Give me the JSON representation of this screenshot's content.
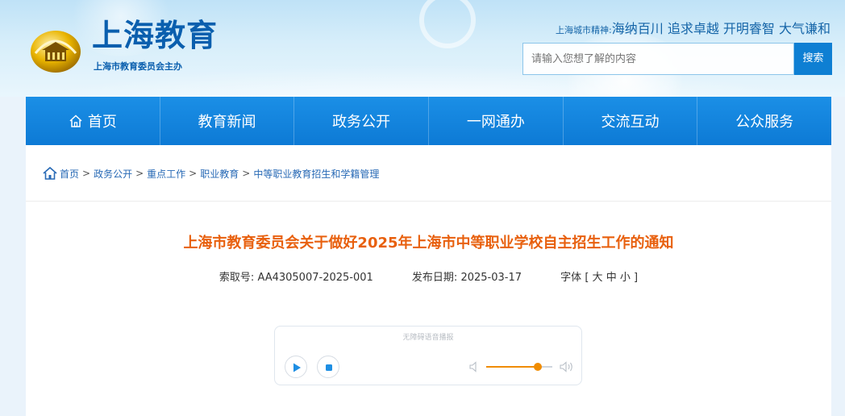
{
  "header": {
    "logo_title": "上海教育",
    "logo_subtitle": "上海市教育委员会主办",
    "motto_label": "上海城市精神:",
    "motto_text": "海纳百川 追求卓越 开明睿智 大气谦和",
    "search": {
      "placeholder": "请输入您想了解的内容",
      "button_label": "搜索"
    }
  },
  "nav": {
    "items": [
      {
        "label": "首页",
        "icon": "home-icon"
      },
      {
        "label": "教育新闻"
      },
      {
        "label": "政务公开"
      },
      {
        "label": "一网通办"
      },
      {
        "label": "交流互动"
      },
      {
        "label": "公众服务"
      }
    ],
    "color": "#0d7ad5"
  },
  "breadcrumb": {
    "icon": "home-icon",
    "items": [
      "首页",
      "政务公开",
      "重点工作",
      "职业教育",
      "中等职业教育招生和学籍管理"
    ],
    "separator": ">"
  },
  "article": {
    "title": "上海市教育委员会关于做好2025年上海市中等职业学校自主招生工作的通知",
    "title_color": "#e8600e",
    "index_label": "索取号:",
    "index_value": "AA4305007-2025-001",
    "date_label": "发布日期:",
    "date_value": "2025-03-17",
    "font_label": "字体",
    "font_open": "[",
    "font_sizes": [
      "大",
      "中",
      "小"
    ],
    "font_close": "]"
  },
  "audio_player": {
    "title": "无障碍语音播报",
    "volume_fraction": 0.78,
    "accent": "#f08c00"
  }
}
